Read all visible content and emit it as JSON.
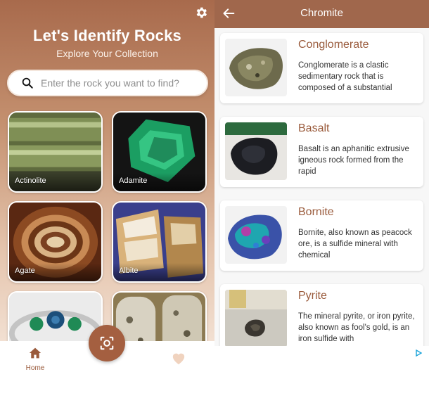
{
  "home": {
    "title": "Let's Identify Rocks",
    "subtitle": "Explore Your Collection",
    "search": {
      "placeholder": "Enter the rock you want to find?"
    },
    "rocks": [
      {
        "label": "Actinolite"
      },
      {
        "label": "Adamite"
      },
      {
        "label": "Agate"
      },
      {
        "label": "Albite"
      },
      {
        "label": ""
      },
      {
        "label": ""
      }
    ],
    "nav": {
      "home_label": "Home"
    }
  },
  "detail": {
    "title": "Chromite",
    "items": [
      {
        "name": "Conglomerate",
        "description": "Conglomerate is a clastic sedimentary rock that is composed of a substantial"
      },
      {
        "name": "Basalt",
        "description": "Basalt is an aphanitic extrusive igneous rock formed from the rapid"
      },
      {
        "name": "Bornite",
        "description": "Bornite, also known as peacock ore, is a sulfide mineral with chemical"
      },
      {
        "name": "Pyrite",
        "description": "The mineral pyrite, or iron pyrite, also known as fool's gold, is an iron sulfide with"
      }
    ]
  },
  "colors": {
    "accent": "#a0674c",
    "accent_text": "#9a5b3c"
  },
  "icons": [
    "gear-icon",
    "search-icon",
    "home-icon",
    "scan-icon",
    "heart-icon",
    "back-arrow-icon",
    "ad-choices-icon"
  ]
}
